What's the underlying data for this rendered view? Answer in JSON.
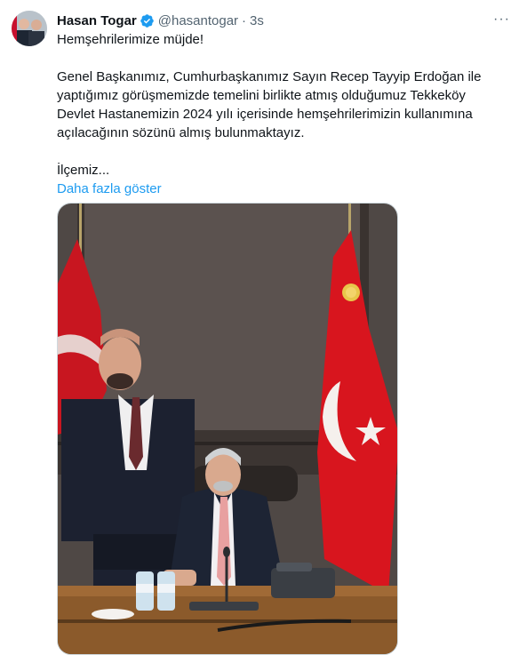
{
  "tweet": {
    "author_name": "Hasan Togar",
    "handle": "@hasantogar",
    "separator": "·",
    "time": "3s",
    "more_label": "···",
    "lines": {
      "l1": "Hemşehrilerimize müjde!",
      "l2": "Genel Başkanımız, Cumhurbaşkanımız Sayın Recep Tayyip Erdoğan ile",
      "l3": "yaptığımız görüşmemizde temelini birlikte atmış olduğumuz Tekkeköy",
      "l4": "Devlet Hastanemizin 2024 yılı içerisinde hemşehrilerimizin kullanımına",
      "l5": "açılacağının sözünü almış bulunmaktayız.",
      "l6": "İlçemiz..."
    },
    "show_more": "Daha fazla göster"
  },
  "colors": {
    "accent": "#1d9bf0",
    "muted": "#536471",
    "flag_red": "#d8151e"
  },
  "icons": {
    "verified": "verified-badge-icon",
    "more": "more-options-icon"
  }
}
